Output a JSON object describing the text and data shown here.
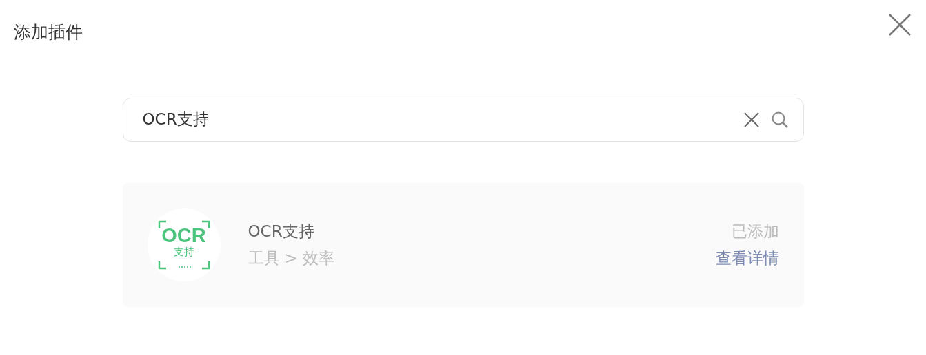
{
  "dialog": {
    "title": "添加插件"
  },
  "search": {
    "value": "OCR支持"
  },
  "results": [
    {
      "logo_title": "OCR",
      "logo_subtitle": "支持",
      "name": "OCR支持",
      "category": "工具 > 效率",
      "status": "已添加",
      "link": "查看详情",
      "added": true
    }
  ]
}
